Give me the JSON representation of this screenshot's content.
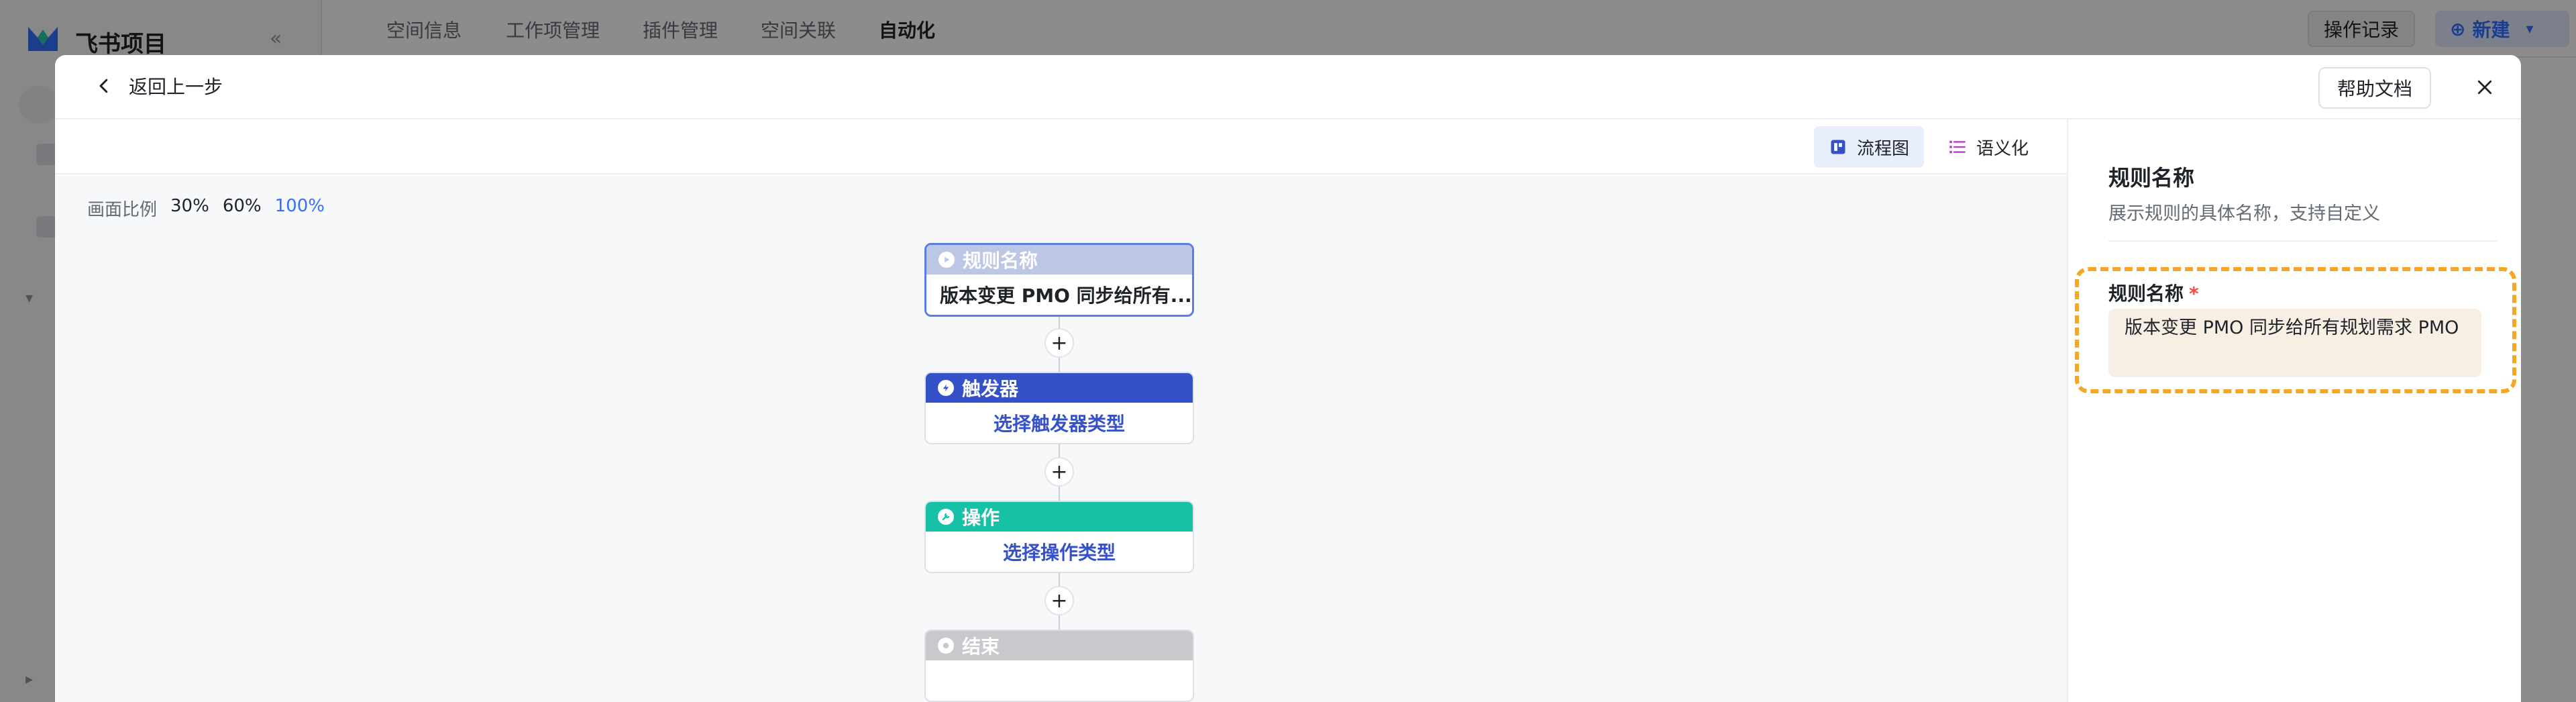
{
  "background": {
    "brand": "飞书项目",
    "collapse_icon": "«",
    "nav_tabs": [
      "空间信息",
      "工作项管理",
      "插件管理",
      "空间关联",
      "自动化"
    ],
    "active_tab_index": 4,
    "log_button": "操作记录",
    "new_button": "新建"
  },
  "header": {
    "back_label": "返回上一步",
    "help_label": "帮助文档"
  },
  "view_switch": {
    "flow_label": "流程图",
    "semantic_label": "语义化"
  },
  "zoom": {
    "label": "画面比例",
    "options": [
      "30%",
      "60%",
      "100%"
    ],
    "selected": "100%"
  },
  "flow": {
    "rule": {
      "head": "规则名称",
      "body": "版本变更 PMO 同步给所有..."
    },
    "trigger": {
      "head": "触发器",
      "body": "选择触发器类型"
    },
    "operation": {
      "head": "操作",
      "body": "选择操作类型"
    },
    "end": {
      "head": "结束",
      "body": ""
    },
    "plus": "+"
  },
  "panel": {
    "title": "规则名称",
    "description": "展示规则的具体名称，支持自定义",
    "field_label": "规则名称",
    "required_mark": "*",
    "field_value": "版本变更 PMO 同步给所有规划需求 PMO"
  },
  "colors": {
    "accent": "#3370ff",
    "trigger": "#3451c7",
    "operation": "#16c1a6",
    "highlight": "#f5a623"
  }
}
